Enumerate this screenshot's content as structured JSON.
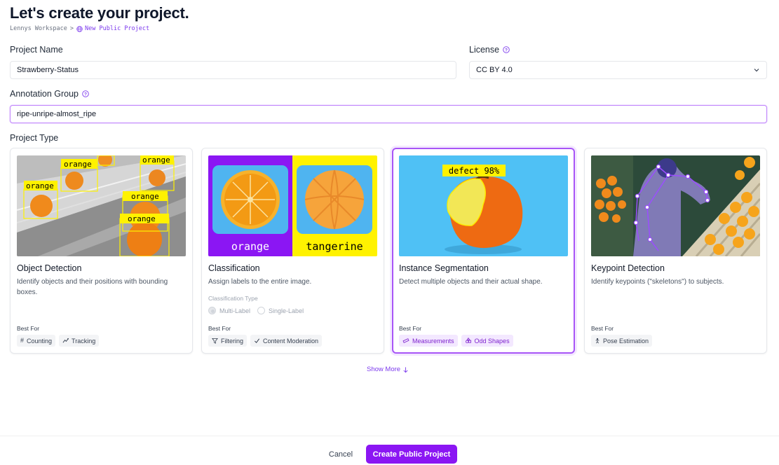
{
  "header": {
    "title": "Let's create your project.",
    "breadcrumb_workspace": "Lennys Workspace",
    "breadcrumb_separator": ">",
    "breadcrumb_current": "New Public Project",
    "breadcrumb_icon": "globe-icon"
  },
  "form": {
    "project_name_label": "Project Name",
    "project_name_value": "Strawberry-Status",
    "license_label": "License",
    "license_value": "CC BY 4.0",
    "annotation_group_label": "Annotation Group",
    "annotation_group_value": "ripe-unripe-almost_ripe",
    "project_type_label": "Project Type"
  },
  "project_types": [
    {
      "title": "Object Detection",
      "description": "Identify objects and their positions with bounding boxes.",
      "best_for_label": "Best For",
      "tags": [
        {
          "label": "Counting",
          "icon": "hash-icon"
        },
        {
          "label": "Tracking",
          "icon": "tracking-icon"
        }
      ],
      "image_labels": [
        "orange",
        "orange",
        "orange",
        "orange",
        "orange"
      ]
    },
    {
      "title": "Classification",
      "description": "Assign labels to the entire image.",
      "classification_type_label": "Classification Type",
      "options": [
        "Multi-Label",
        "Single-Label"
      ],
      "best_for_label": "Best For",
      "tags": [
        {
          "label": "Filtering",
          "icon": "filter-icon"
        },
        {
          "label": "Content Moderation",
          "icon": "check-icon"
        }
      ],
      "image_labels": [
        "orange",
        "tangerine"
      ]
    },
    {
      "title": "Instance Segmentation",
      "description": "Detect multiple objects and their actual shape.",
      "best_for_label": "Best For",
      "selected": true,
      "tags": [
        {
          "label": "Measurements",
          "icon": "ruler-icon"
        },
        {
          "label": "Odd Shapes",
          "icon": "shapes-icon"
        }
      ],
      "image_labels": [
        "defect 98%"
      ]
    },
    {
      "title": "Keypoint Detection",
      "description": "Identify keypoints (\"skeletons\") to subjects.",
      "best_for_label": "Best For",
      "tags": [
        {
          "label": "Pose Estimation",
          "icon": "person-icon"
        }
      ]
    }
  ],
  "show_more_label": "Show More",
  "footer": {
    "cancel_label": "Cancel",
    "create_label": "Create Public Project"
  },
  "colors": {
    "accent": "#8b16f3",
    "accent_light": "#f3e8ff",
    "label_yellow": "#fff200"
  }
}
